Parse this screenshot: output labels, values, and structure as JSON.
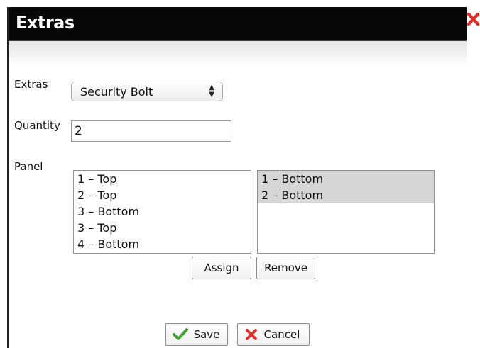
{
  "dialog": {
    "title": "Extras"
  },
  "form": {
    "extras_label": "Extras",
    "extras_selected": "Security Bolt",
    "quantity_label": "Quantity",
    "quantity_value": "2",
    "panel_label": "Panel"
  },
  "available_panels": [
    "1 – Top",
    "2 – Top",
    "3 – Bottom",
    "3 – Top",
    "4 – Bottom"
  ],
  "assigned_panels": [
    "1 – Bottom",
    "2 – Bottom"
  ],
  "buttons": {
    "assign": "Assign",
    "remove": "Remove",
    "save": "Save",
    "cancel": "Cancel"
  },
  "icons": {
    "close": "close-x-icon",
    "save": "checkmark-icon",
    "cancel": "red-x-icon"
  },
  "colors": {
    "titlebar": "#080808",
    "close_red": "#e0302a",
    "check_green": "#3fa535",
    "selected_row": "#d6d6d6"
  }
}
